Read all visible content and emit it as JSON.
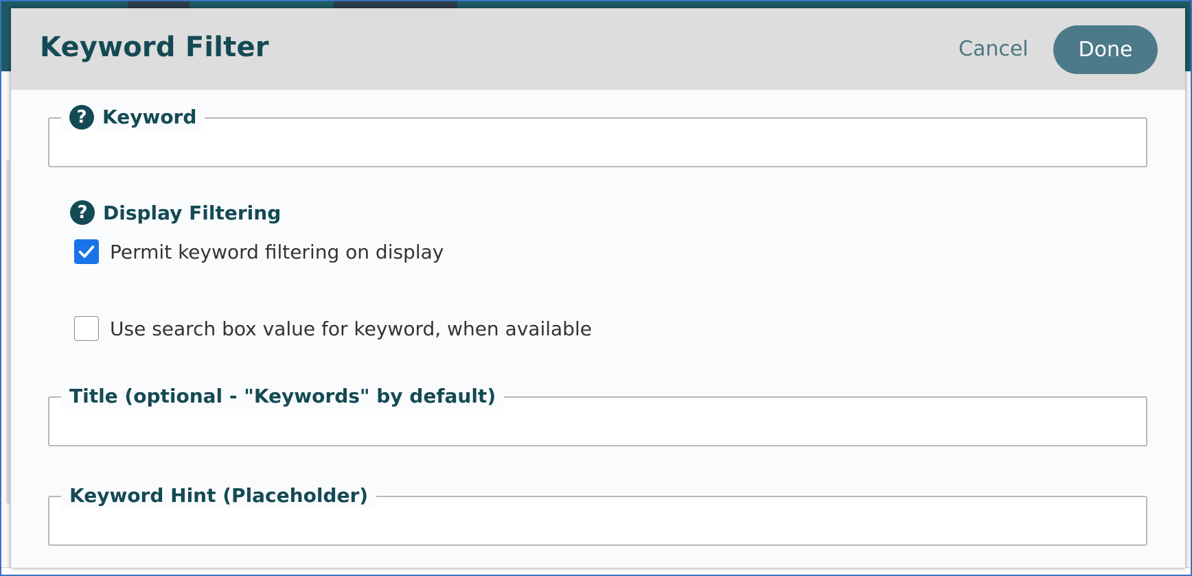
{
  "dialog": {
    "title": "Keyword Filter",
    "cancel_label": "Cancel",
    "done_label": "Done"
  },
  "keyword_field": {
    "label": "Keyword",
    "value": "",
    "help_icon": "question-circle-icon"
  },
  "display_filtering": {
    "label": "Display Filtering",
    "help_icon": "question-circle-icon",
    "options": [
      {
        "label": "Permit keyword filtering on display",
        "checked": true
      },
      {
        "label": "Use search box value for keyword, when available",
        "checked": false
      }
    ]
  },
  "title_field": {
    "label": "Title (optional - \"Keywords\" by default)",
    "value": ""
  },
  "hint_field": {
    "label": "Keyword Hint (Placeholder)",
    "value": ""
  },
  "colors": {
    "accent": "#144a53",
    "done_button": "#4c7a88",
    "checkbox_checked": "#1a73e8",
    "header_bg": "#dddddd"
  }
}
